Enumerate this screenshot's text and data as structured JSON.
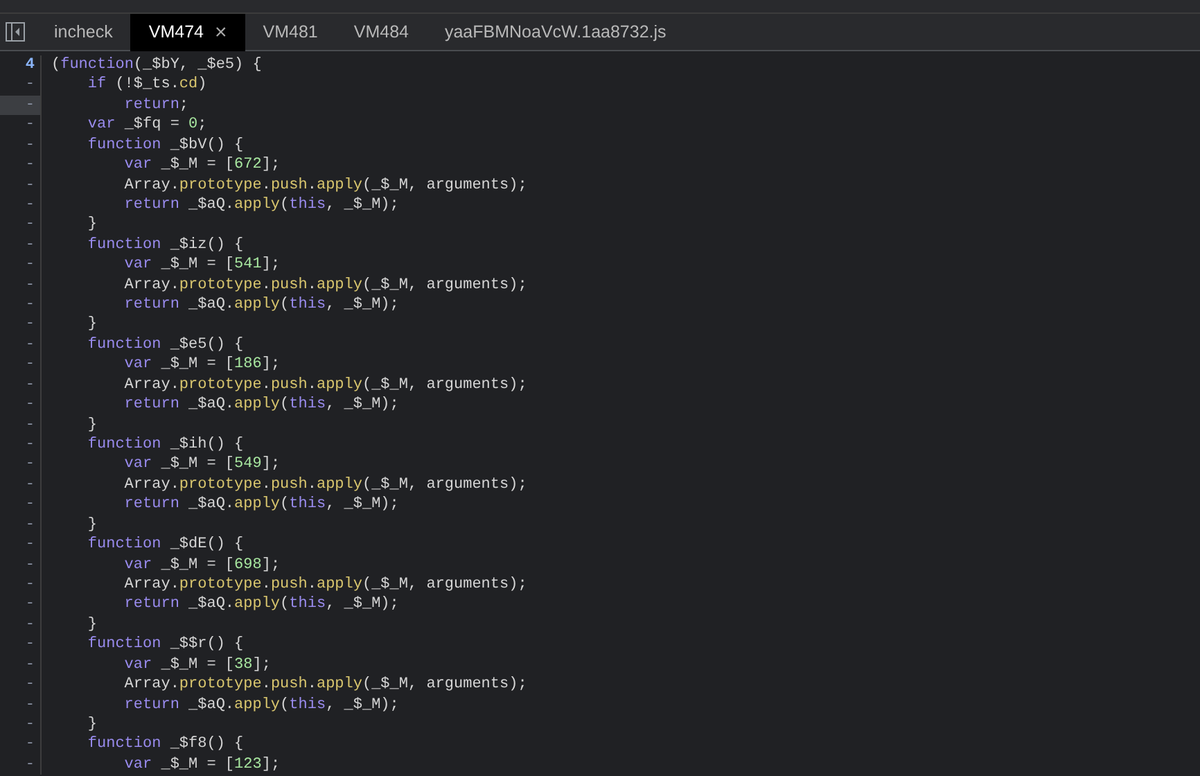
{
  "tabs": [
    {
      "label": "incheck",
      "selected": false,
      "closable": false
    },
    {
      "label": "VM474",
      "selected": true,
      "closable": true
    },
    {
      "label": "VM481",
      "selected": false,
      "closable": false
    },
    {
      "label": "VM484",
      "selected": false,
      "closable": false
    },
    {
      "label": "yaaFBMNoaVcW.1aa8732.js",
      "selected": false,
      "closable": false
    }
  ],
  "close_glyph": "×",
  "code_lines": [
    {
      "gutter": "4",
      "highlighted": false,
      "tokens": [
        {
          "kind": "plain",
          "text": "("
        },
        {
          "kind": "keyword",
          "text": "function"
        },
        {
          "kind": "plain",
          "text": "(_$bY, _$e5) {"
        }
      ]
    },
    {
      "gutter": "-",
      "highlighted": false,
      "tokens": [
        {
          "kind": "keyword",
          "text": "    if"
        },
        {
          "kind": "plain",
          "text": " (!$_ts."
        },
        {
          "kind": "property",
          "text": "cd"
        },
        {
          "kind": "plain",
          "text": ")"
        }
      ]
    },
    {
      "gutter": "-",
      "highlighted": true,
      "tokens": [
        {
          "kind": "keyword",
          "text": "        return"
        },
        {
          "kind": "plain",
          "text": ";"
        }
      ]
    },
    {
      "gutter": "-",
      "highlighted": false,
      "tokens": [
        {
          "kind": "keyword",
          "text": "    var"
        },
        {
          "kind": "plain",
          "text": " _$fq = "
        },
        {
          "kind": "number",
          "text": "0"
        },
        {
          "kind": "plain",
          "text": ";"
        }
      ]
    },
    {
      "gutter": "-",
      "highlighted": false,
      "tokens": [
        {
          "kind": "keyword",
          "text": "    function"
        },
        {
          "kind": "plain",
          "text": " _$bV() {"
        }
      ]
    },
    {
      "gutter": "-",
      "highlighted": false,
      "tokens": [
        {
          "kind": "keyword",
          "text": "        var"
        },
        {
          "kind": "plain",
          "text": " _$_M = ["
        },
        {
          "kind": "number",
          "text": "672"
        },
        {
          "kind": "plain",
          "text": "];"
        }
      ]
    },
    {
      "gutter": "-",
      "highlighted": false,
      "tokens": [
        {
          "kind": "plain",
          "text": "        Array."
        },
        {
          "kind": "property",
          "text": "prototype"
        },
        {
          "kind": "plain",
          "text": "."
        },
        {
          "kind": "property",
          "text": "push"
        },
        {
          "kind": "plain",
          "text": "."
        },
        {
          "kind": "property",
          "text": "apply"
        },
        {
          "kind": "plain",
          "text": "(_$_M, arguments);"
        }
      ]
    },
    {
      "gutter": "-",
      "highlighted": false,
      "tokens": [
        {
          "kind": "keyword",
          "text": "        return"
        },
        {
          "kind": "plain",
          "text": " _$aQ."
        },
        {
          "kind": "property",
          "text": "apply"
        },
        {
          "kind": "plain",
          "text": "("
        },
        {
          "kind": "keyword",
          "text": "this"
        },
        {
          "kind": "plain",
          "text": ", _$_M);"
        }
      ]
    },
    {
      "gutter": "-",
      "highlighted": false,
      "tokens": [
        {
          "kind": "plain",
          "text": "    }"
        }
      ]
    },
    {
      "gutter": "-",
      "highlighted": false,
      "tokens": [
        {
          "kind": "keyword",
          "text": "    function"
        },
        {
          "kind": "plain",
          "text": " _$iz() {"
        }
      ]
    },
    {
      "gutter": "-",
      "highlighted": false,
      "tokens": [
        {
          "kind": "keyword",
          "text": "        var"
        },
        {
          "kind": "plain",
          "text": " _$_M = ["
        },
        {
          "kind": "number",
          "text": "541"
        },
        {
          "kind": "plain",
          "text": "];"
        }
      ]
    },
    {
      "gutter": "-",
      "highlighted": false,
      "tokens": [
        {
          "kind": "plain",
          "text": "        Array."
        },
        {
          "kind": "property",
          "text": "prototype"
        },
        {
          "kind": "plain",
          "text": "."
        },
        {
          "kind": "property",
          "text": "push"
        },
        {
          "kind": "plain",
          "text": "."
        },
        {
          "kind": "property",
          "text": "apply"
        },
        {
          "kind": "plain",
          "text": "(_$_M, arguments);"
        }
      ]
    },
    {
      "gutter": "-",
      "highlighted": false,
      "tokens": [
        {
          "kind": "keyword",
          "text": "        return"
        },
        {
          "kind": "plain",
          "text": " _$aQ."
        },
        {
          "kind": "property",
          "text": "apply"
        },
        {
          "kind": "plain",
          "text": "("
        },
        {
          "kind": "keyword",
          "text": "this"
        },
        {
          "kind": "plain",
          "text": ", _$_M);"
        }
      ]
    },
    {
      "gutter": "-",
      "highlighted": false,
      "tokens": [
        {
          "kind": "plain",
          "text": "    }"
        }
      ]
    },
    {
      "gutter": "-",
      "highlighted": false,
      "tokens": [
        {
          "kind": "keyword",
          "text": "    function"
        },
        {
          "kind": "plain",
          "text": " _$e5() {"
        }
      ]
    },
    {
      "gutter": "-",
      "highlighted": false,
      "tokens": [
        {
          "kind": "keyword",
          "text": "        var"
        },
        {
          "kind": "plain",
          "text": " _$_M = ["
        },
        {
          "kind": "number",
          "text": "186"
        },
        {
          "kind": "plain",
          "text": "];"
        }
      ]
    },
    {
      "gutter": "-",
      "highlighted": false,
      "tokens": [
        {
          "kind": "plain",
          "text": "        Array."
        },
        {
          "kind": "property",
          "text": "prototype"
        },
        {
          "kind": "plain",
          "text": "."
        },
        {
          "kind": "property",
          "text": "push"
        },
        {
          "kind": "plain",
          "text": "."
        },
        {
          "kind": "property",
          "text": "apply"
        },
        {
          "kind": "plain",
          "text": "(_$_M, arguments);"
        }
      ]
    },
    {
      "gutter": "-",
      "highlighted": false,
      "tokens": [
        {
          "kind": "keyword",
          "text": "        return"
        },
        {
          "kind": "plain",
          "text": " _$aQ."
        },
        {
          "kind": "property",
          "text": "apply"
        },
        {
          "kind": "plain",
          "text": "("
        },
        {
          "kind": "keyword",
          "text": "this"
        },
        {
          "kind": "plain",
          "text": ", _$_M);"
        }
      ]
    },
    {
      "gutter": "-",
      "highlighted": false,
      "tokens": [
        {
          "kind": "plain",
          "text": "    }"
        }
      ]
    },
    {
      "gutter": "-",
      "highlighted": false,
      "tokens": [
        {
          "kind": "keyword",
          "text": "    function"
        },
        {
          "kind": "plain",
          "text": " _$ih() {"
        }
      ]
    },
    {
      "gutter": "-",
      "highlighted": false,
      "tokens": [
        {
          "kind": "keyword",
          "text": "        var"
        },
        {
          "kind": "plain",
          "text": " _$_M = ["
        },
        {
          "kind": "number",
          "text": "549"
        },
        {
          "kind": "plain",
          "text": "];"
        }
      ]
    },
    {
      "gutter": "-",
      "highlighted": false,
      "tokens": [
        {
          "kind": "plain",
          "text": "        Array."
        },
        {
          "kind": "property",
          "text": "prototype"
        },
        {
          "kind": "plain",
          "text": "."
        },
        {
          "kind": "property",
          "text": "push"
        },
        {
          "kind": "plain",
          "text": "."
        },
        {
          "kind": "property",
          "text": "apply"
        },
        {
          "kind": "plain",
          "text": "(_$_M, arguments);"
        }
      ]
    },
    {
      "gutter": "-",
      "highlighted": false,
      "tokens": [
        {
          "kind": "keyword",
          "text": "        return"
        },
        {
          "kind": "plain",
          "text": " _$aQ."
        },
        {
          "kind": "property",
          "text": "apply"
        },
        {
          "kind": "plain",
          "text": "("
        },
        {
          "kind": "keyword",
          "text": "this"
        },
        {
          "kind": "plain",
          "text": ", _$_M);"
        }
      ]
    },
    {
      "gutter": "-",
      "highlighted": false,
      "tokens": [
        {
          "kind": "plain",
          "text": "    }"
        }
      ]
    },
    {
      "gutter": "-",
      "highlighted": false,
      "tokens": [
        {
          "kind": "keyword",
          "text": "    function"
        },
        {
          "kind": "plain",
          "text": " _$dE() {"
        }
      ]
    },
    {
      "gutter": "-",
      "highlighted": false,
      "tokens": [
        {
          "kind": "keyword",
          "text": "        var"
        },
        {
          "kind": "plain",
          "text": " _$_M = ["
        },
        {
          "kind": "number",
          "text": "698"
        },
        {
          "kind": "plain",
          "text": "];"
        }
      ]
    },
    {
      "gutter": "-",
      "highlighted": false,
      "tokens": [
        {
          "kind": "plain",
          "text": "        Array."
        },
        {
          "kind": "property",
          "text": "prototype"
        },
        {
          "kind": "plain",
          "text": "."
        },
        {
          "kind": "property",
          "text": "push"
        },
        {
          "kind": "plain",
          "text": "."
        },
        {
          "kind": "property",
          "text": "apply"
        },
        {
          "kind": "plain",
          "text": "(_$_M, arguments);"
        }
      ]
    },
    {
      "gutter": "-",
      "highlighted": false,
      "tokens": [
        {
          "kind": "keyword",
          "text": "        return"
        },
        {
          "kind": "plain",
          "text": " _$aQ."
        },
        {
          "kind": "property",
          "text": "apply"
        },
        {
          "kind": "plain",
          "text": "("
        },
        {
          "kind": "keyword",
          "text": "this"
        },
        {
          "kind": "plain",
          "text": ", _$_M);"
        }
      ]
    },
    {
      "gutter": "-",
      "highlighted": false,
      "tokens": [
        {
          "kind": "plain",
          "text": "    }"
        }
      ]
    },
    {
      "gutter": "-",
      "highlighted": false,
      "tokens": [
        {
          "kind": "keyword",
          "text": "    function"
        },
        {
          "kind": "plain",
          "text": " _$$r() {"
        }
      ]
    },
    {
      "gutter": "-",
      "highlighted": false,
      "tokens": [
        {
          "kind": "keyword",
          "text": "        var"
        },
        {
          "kind": "plain",
          "text": " _$_M = ["
        },
        {
          "kind": "number",
          "text": "38"
        },
        {
          "kind": "plain",
          "text": "];"
        }
      ]
    },
    {
      "gutter": "-",
      "highlighted": false,
      "tokens": [
        {
          "kind": "plain",
          "text": "        Array."
        },
        {
          "kind": "property",
          "text": "prototype"
        },
        {
          "kind": "plain",
          "text": "."
        },
        {
          "kind": "property",
          "text": "push"
        },
        {
          "kind": "plain",
          "text": "."
        },
        {
          "kind": "property",
          "text": "apply"
        },
        {
          "kind": "plain",
          "text": "(_$_M, arguments);"
        }
      ]
    },
    {
      "gutter": "-",
      "highlighted": false,
      "tokens": [
        {
          "kind": "keyword",
          "text": "        return"
        },
        {
          "kind": "plain",
          "text": " _$aQ."
        },
        {
          "kind": "property",
          "text": "apply"
        },
        {
          "kind": "plain",
          "text": "("
        },
        {
          "kind": "keyword",
          "text": "this"
        },
        {
          "kind": "plain",
          "text": ", _$_M);"
        }
      ]
    },
    {
      "gutter": "-",
      "highlighted": false,
      "tokens": [
        {
          "kind": "plain",
          "text": "    }"
        }
      ]
    },
    {
      "gutter": "-",
      "highlighted": false,
      "tokens": [
        {
          "kind": "keyword",
          "text": "    function"
        },
        {
          "kind": "plain",
          "text": " _$f8() {"
        }
      ]
    },
    {
      "gutter": "-",
      "highlighted": false,
      "tokens": [
        {
          "kind": "keyword",
          "text": "        var"
        },
        {
          "kind": "plain",
          "text": " _$_M = ["
        },
        {
          "kind": "number",
          "text": "123"
        },
        {
          "kind": "plain",
          "text": "];"
        }
      ]
    }
  ]
}
